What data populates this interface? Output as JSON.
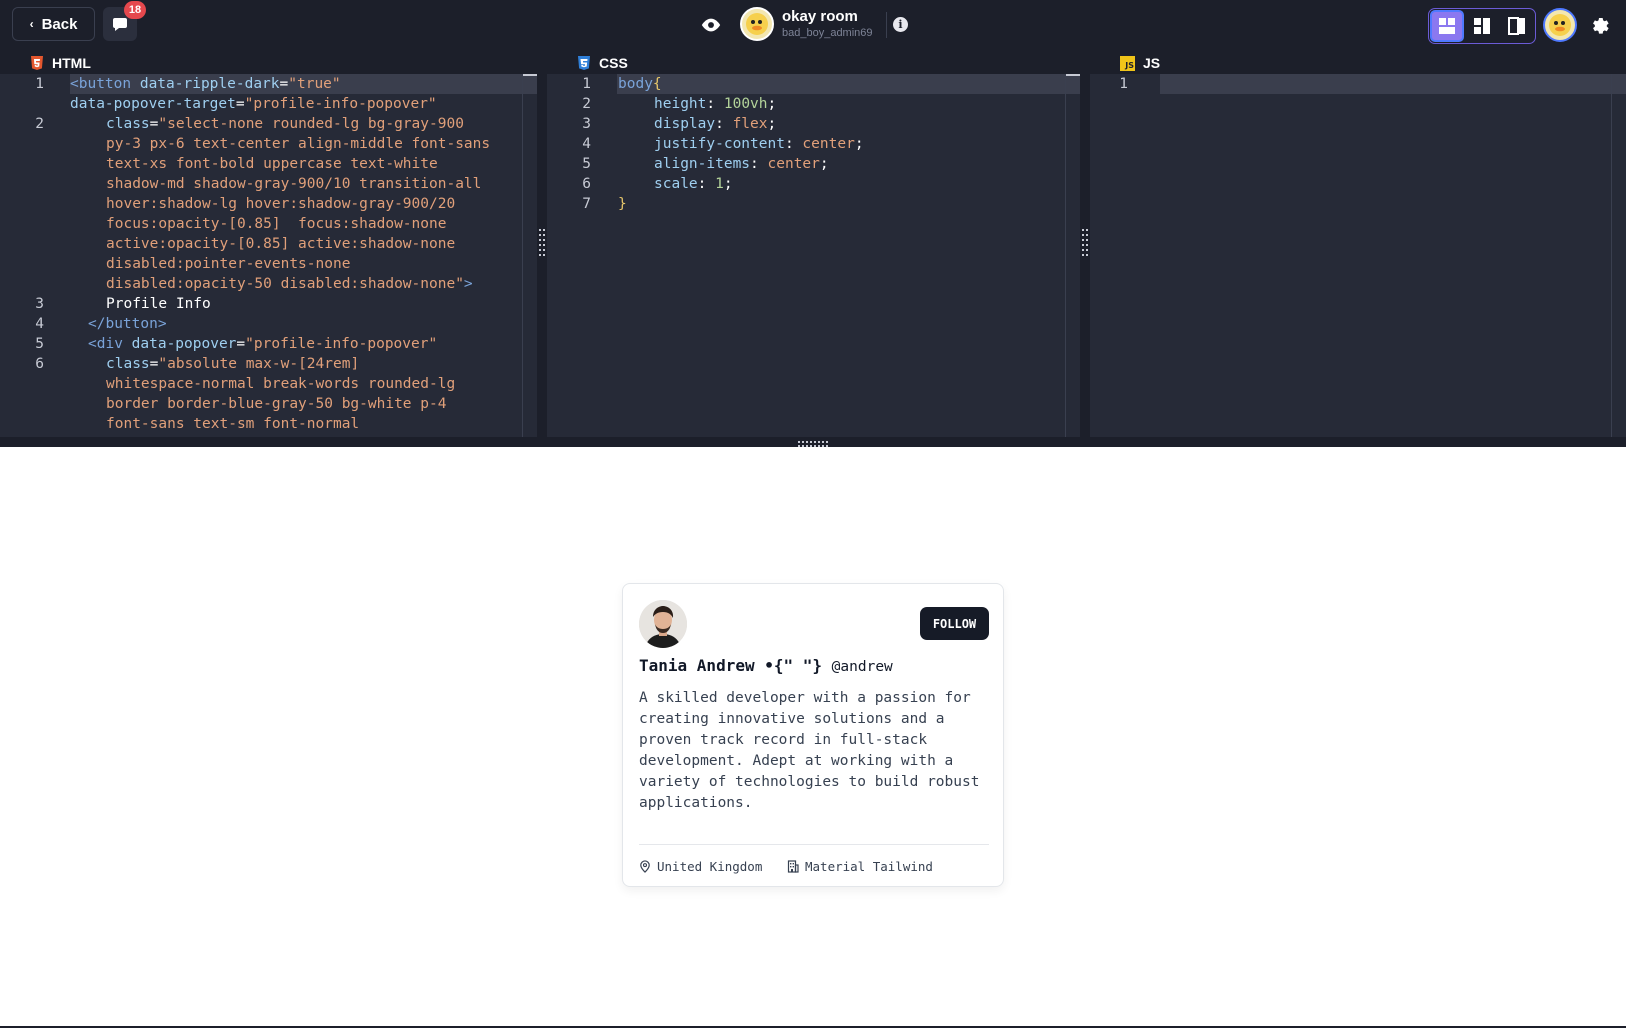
{
  "topbar": {
    "back_label": "Back",
    "notifications_count": "18",
    "room_title": "okay room",
    "room_user": "bad_boy_admin69",
    "info_glyph": "i",
    "layout_options": [
      "grid-layout",
      "sidebar-layout",
      "split-layout"
    ],
    "active_layout": "grid-layout"
  },
  "editors": {
    "html": {
      "title": "HTML",
      "line_numbers": [
        "1",
        "2",
        "3",
        "4",
        "5",
        "6"
      ],
      "l1_tag": "<button",
      "l1_attr": " data-ripple-dark",
      "l1_eq": "=",
      "l1_val": "\"true\"",
      "l1b_attr": "data-popover-target",
      "l1b_eq": "=",
      "l1b_val": "\"profile-info-popover\"",
      "l2_attr": "class",
      "l2_eq": "=",
      "l2_rows": [
        "\"select-none rounded-lg bg-gray-900",
        "py-3 px-6 text-center align-middle font-sans",
        "text-xs font-bold uppercase text-white",
        "shadow-md shadow-gray-900/10 transition-all",
        "hover:shadow-lg hover:shadow-gray-900/20",
        "focus:opacity-[0.85]  focus:shadow-none",
        "active:opacity-[0.85] active:shadow-none",
        "disabled:pointer-events-none",
        "disabled:opacity-50 disabled:shadow-none\""
      ],
      "l2_close": ">",
      "l3": "Profile Info",
      "l4": "</button>",
      "l5_tag": "<div",
      "l5_attr": " data-popover",
      "l5_eq": "=",
      "l5_val": "\"profile-info-popover\"",
      "l6_attr": "class",
      "l6_eq": "=",
      "l6_rows": [
        "\"absolute max-w-[24rem]",
        "whitespace-normal break-words rounded-lg",
        "border border-blue-gray-50 bg-white p-4",
        "font-sans text-sm font-normal"
      ]
    },
    "css": {
      "title": "CSS",
      "line_numbers": [
        "1",
        "2",
        "3",
        "4",
        "5",
        "6",
        "7"
      ],
      "selector": "body",
      "open": "{",
      "close": "}",
      "rules": [
        {
          "prop": "height",
          "value": "100vh"
        },
        {
          "prop": "display",
          "value": "flex"
        },
        {
          "prop": "justify-content",
          "value": "center"
        },
        {
          "prop": "align-items",
          "value": "center"
        },
        {
          "prop": "scale",
          "value": "1"
        }
      ]
    },
    "js": {
      "title": "JS",
      "line_numbers": [
        "1"
      ],
      "icon_text": "JS"
    }
  },
  "preview": {
    "card": {
      "name": "Tania Andrew •{\" \"}",
      "handle": "@andrew",
      "follow_label": "FOLLOW",
      "bio": "A skilled developer with a passion for creating innovative solutions and a proven track record in full-stack development. Adept at working with a variety of technologies to build robust applications.",
      "location": "United Kingdom",
      "company": "Material Tailwind"
    }
  },
  "colors": {
    "topbar_bg": "#1c1f2a",
    "editor_bg": "#262a37",
    "accent": "#8b78f0",
    "badge": "#e5484d",
    "follow_btn": "#161b27"
  }
}
